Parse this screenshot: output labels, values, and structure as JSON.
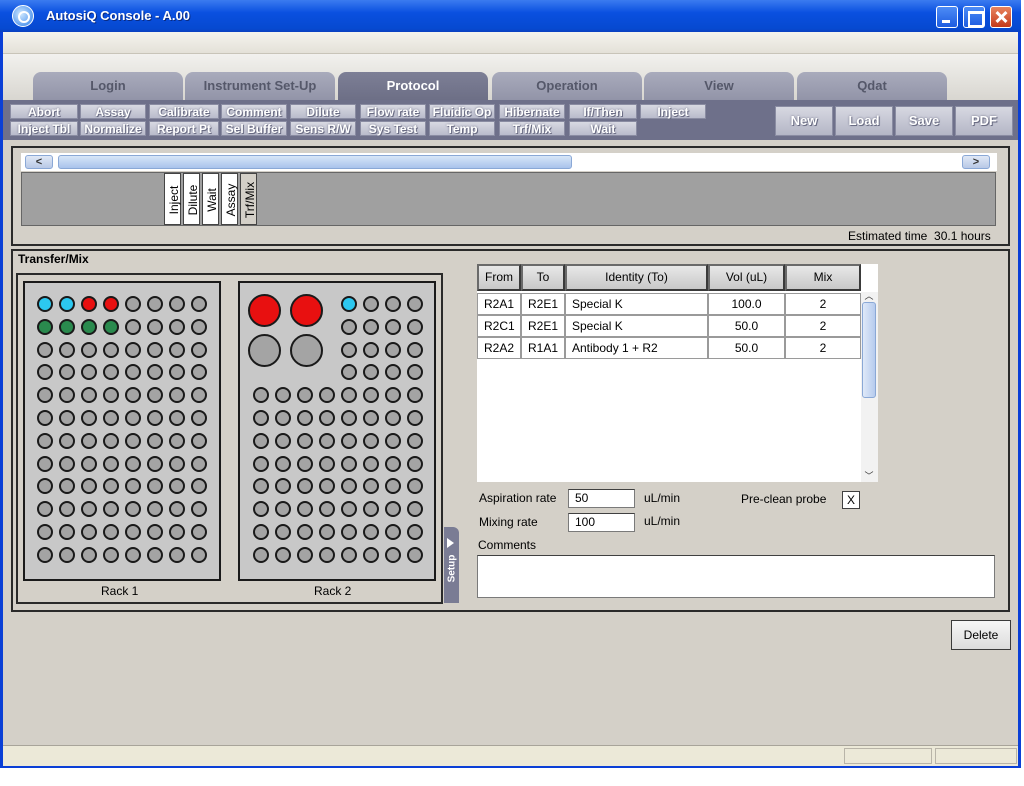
{
  "window": {
    "title": "AutosiQ Console - A.00"
  },
  "tabs": [
    "Login",
    "Instrument Set-Up",
    "Protocol",
    "Operation",
    "View",
    "Qdat"
  ],
  "selected_tab": "Protocol",
  "commands": {
    "row1": [
      "Abort",
      "Assay",
      "Calibrate",
      "Comment",
      "Dilute",
      "Flow rate",
      "Fluidic Op",
      "Hibernate",
      "If/Then",
      "Inject"
    ],
    "row2": [
      "Inject Tbl",
      "Normalize",
      "Report Pt",
      "Sel Buffer",
      "Sens R/W",
      "Sys Test",
      "Temp",
      "Trf/Mix",
      "Wait"
    ]
  },
  "file_buttons": [
    "New",
    "Load",
    "Save",
    "PDF"
  ],
  "sequence": {
    "scroll_left": "<",
    "scroll_right": ">",
    "steps": [
      "Inject",
      "Dilute",
      "Wait",
      "Assay",
      "Trf/Mix"
    ],
    "estimated_label": "Estimated time",
    "estimated_value": "30.1 hours"
  },
  "section_title": "Transfer/Mix",
  "racks": {
    "rack1_label": "Rack 1",
    "rack2_label": "Rack 2",
    "rack1_colored": {
      "row1": [
        "cyan",
        "cyan",
        "red",
        "red"
      ],
      "row2": [
        "green",
        "green",
        "green",
        "green"
      ]
    },
    "rack2_big_wells": [
      "red",
      "red",
      "gray",
      "gray"
    ],
    "rack2_colored": {
      "row1_first": "cyan"
    },
    "setup_tab": "Setup"
  },
  "table": {
    "headers": [
      "From",
      "To",
      "Identity (To)",
      "Vol (uL)",
      "Mix"
    ],
    "rows": [
      [
        "R2A1",
        "R2E1",
        "Special K",
        "100.0",
        "2"
      ],
      [
        "R2C1",
        "R2E1",
        "Special K",
        "50.0",
        "2"
      ],
      [
        "R2A2",
        "R1A1",
        "Antibody 1 + R2",
        "50.0",
        "2"
      ]
    ]
  },
  "settings": {
    "aspiration_label": "Aspiration rate",
    "aspiration_value": "50",
    "aspiration_unit": "uL/min",
    "mixing_label": "Mixing rate",
    "mixing_value": "100",
    "mixing_unit": "uL/min",
    "preclean_label": "Pre-clean probe",
    "preclean_value": "X",
    "comments_label": "Comments",
    "comments_value": ""
  },
  "delete_label": "Delete",
  "icons": {
    "app": "app-logo-icon",
    "minimize": "minimize-icon",
    "maximize": "maximize-icon",
    "close": "close-icon"
  }
}
